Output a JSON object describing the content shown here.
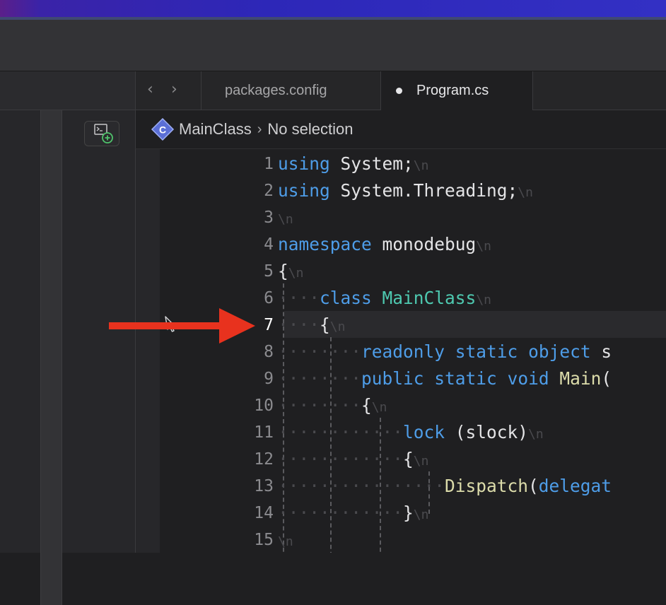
{
  "tabs": [
    {
      "label": "packages.config",
      "active": false
    },
    {
      "label": "Program.cs",
      "active": true,
      "modified": true
    }
  ],
  "breadcrumb": {
    "icon_letter": "C",
    "class_name": "MainClass",
    "separator": "›",
    "selection": "No selection"
  },
  "nav": {
    "back": "‹",
    "forward": "›"
  },
  "editor": {
    "current_line": "7",
    "newline_marker": "\\n",
    "lines": [
      {
        "n": "1"
      },
      {
        "n": "2"
      },
      {
        "n": "3"
      },
      {
        "n": "4"
      },
      {
        "n": "5"
      },
      {
        "n": "6"
      },
      {
        "n": "7"
      },
      {
        "n": "8"
      },
      {
        "n": "9"
      },
      {
        "n": "10"
      },
      {
        "n": "11"
      },
      {
        "n": "12"
      },
      {
        "n": "13"
      },
      {
        "n": "14"
      },
      {
        "n": "15"
      }
    ],
    "tokens": {
      "l1_kw": "using",
      "l1_rest": " System;",
      "l2_kw": "using",
      "l2_rest": " System.Threading;",
      "l4_kw": "namespace",
      "l4_rest": " monodebug",
      "l5": "{",
      "l6_kw": "class",
      "l6_type": "MainClass",
      "l7": "{",
      "l8_kw1": "readonly",
      "l8_kw2": "static",
      "l8_kw3": "object",
      "l8_rest": " s",
      "l9_kw1": "public",
      "l9_kw2": "static",
      "l9_kw3": "void",
      "l9_fn": "Main",
      "l9_rest": "(",
      "l10": "{",
      "l11_kw": "lock",
      "l11_rest": " (slock)",
      "l12": "{",
      "l13_fn": "Dispatch",
      "l13_rest": "(",
      "l13_kw": "delegat",
      "l14": "}"
    }
  },
  "colors": {
    "keyword": "#4e9de8",
    "type": "#4ec9b0",
    "function": "#dcdcaa",
    "annotation_arrow": "#e8321e"
  },
  "icons": [
    "terminal-add-icon",
    "class-icon",
    "back-arrow-icon",
    "forward-arrow-icon",
    "pointer-icon"
  ]
}
